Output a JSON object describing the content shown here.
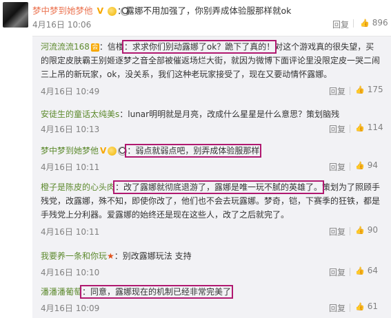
{
  "top_comment": {
    "username": "梦中梦到她梦他",
    "text": "：露娜不用加强了，你别弄成体验服那样就ok",
    "time": "4月16日 10:06",
    "reply_label": "回复",
    "likes": "896"
  },
  "replies": [
    {
      "username": "河流流流168",
      "prefix": "：信楼",
      "highlight": "：求求你们别动露娜了ok？跪下了真的！",
      "lines": [
        "对这个游戏真的很失望，买",
        "的限定皮肤霸王别姬逐梦之音全部被催返场烂大街，就因为微博下面评论里没限定皮一哭二闹",
        "三上吊的新玩家，ok，没关系，我们这种老玩家接受了，现在又要动情怀露娜。"
      ],
      "time": "4月16日 10:49",
      "reply_label": "回复",
      "likes": "175"
    },
    {
      "username": "安徒生的童话太纯美s",
      "text": "：lunar明明就是月亮，改成什么星星是什么意思？策划脑残",
      "time": "4月16日 10:13",
      "reply_label": "回复",
      "likes": "114"
    },
    {
      "username": "梦中梦到她梦他",
      "highlight": "：弱点就弱点吧，别弄成体验服那样",
      "time": "4月16日 10:11",
      "reply_label": "回复",
      "likes": "94"
    },
    {
      "username": "橙子是陈皮的心头肉",
      "highlight": "：改了露娜就彻底退游了，露娜是唯一玩不腻的英雄了。",
      "lines": [
        "策划为了照顾手",
        "残党，改露娜，殊不知，即使你改了，他们也不会去玩露娜。梦奇，铠，下赛季的狂铁，都是",
        "手残党上分利器。爱露娜的始终还是现在这些人，改了之后就完了。"
      ],
      "time": "4月16日 10:11",
      "reply_label": "回复",
      "likes": "90"
    },
    {
      "username": "我要养一条和你玩",
      "text": "：别改露娜玩法 支持",
      "time": "4月16日 10:10",
      "reply_label": "回复",
      "likes": "64"
    },
    {
      "username": "潘潘潘葡萄",
      "highlight": "：同意，露娜现在的机制已经非常完美了",
      "time": "4月16日 10:09",
      "reply_label": "回复",
      "likes": "61"
    }
  ]
}
